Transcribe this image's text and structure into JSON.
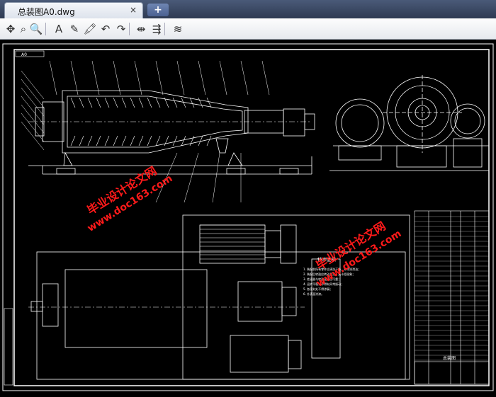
{
  "tab": {
    "title": "总装图A0.dwg",
    "close_glyph": "×",
    "add_glyph": "+"
  },
  "toolbar": {
    "tools": [
      {
        "name": "pan-icon",
        "glyph": "✥"
      },
      {
        "name": "zoom-window-icon",
        "glyph": "⌕"
      },
      {
        "name": "zoom-realtime-icon",
        "glyph": "🔍"
      },
      {
        "name": "text-tool-icon",
        "glyph": "A"
      },
      {
        "name": "pencil-icon",
        "glyph": "✎"
      },
      {
        "name": "highlighter-icon",
        "glyph": "🖍"
      },
      {
        "name": "undo-icon",
        "glyph": "↶"
      },
      {
        "name": "redo-icon",
        "glyph": "↷"
      },
      {
        "name": "measure-distance-icon",
        "glyph": "⇹"
      },
      {
        "name": "measure-area-icon",
        "glyph": "⇶"
      },
      {
        "name": "layers-icon",
        "glyph": "≋"
      }
    ]
  },
  "drawing": {
    "title_block_label": "总装图",
    "notes_title": "技术要求",
    "notes": [
      "1. 装配前所有零件应清洗干净，并涂润滑油；",
      "2. 装配后转鼓应转动灵活，无卡阻现象；",
      "3. 差速器与转鼓连接应可靠；",
      "4. 运转平稳，不得有异常振动；",
      "5. 各密封处不得渗漏；",
      "6. 外表面涂漆。"
    ],
    "frame_tag": "A0"
  },
  "watermarks": [
    {
      "line1": "毕业设计论文网",
      "line2": "www.doc163.com"
    },
    {
      "line1": "毕业设计论文网",
      "line2": "www.doc163.com"
    }
  ],
  "colors": {
    "line": "#ffffff",
    "accent": "#ff1a1a",
    "background": "#000000"
  }
}
